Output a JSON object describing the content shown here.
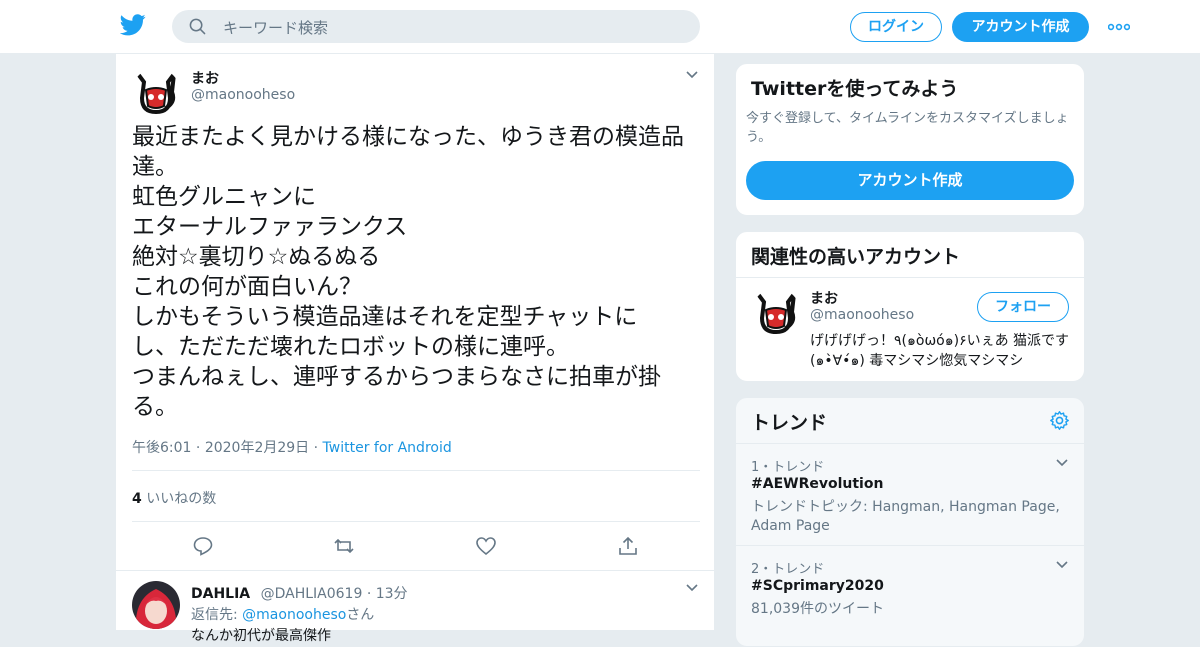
{
  "header": {
    "search_placeholder": "キーワード検索",
    "login_label": "ログイン",
    "signup_label": "アカウント作成"
  },
  "tweet": {
    "name": "まお",
    "handle": "@maonooheso",
    "lines": [
      "最近またよく見かける様になった、ゆうき君の模造品",
      "達。",
      "虹色グルニャンに",
      "エターナルファァランクス",
      "絶対☆裏切り☆ぬるぬる",
      "これの何が面白いん？",
      "しかもそういう模造品達はそれを定型チャットに",
      "し、ただただ壊れたロボットの様に連呼。",
      "つまんねぇし、連呼するからつまらなさに拍車が掛",
      "る。"
    ],
    "time": "午後6:01",
    "date": "2020年2月29日",
    "source": "Twitter for Android",
    "like_count": "4",
    "like_label": "いいねの数"
  },
  "reply": {
    "name": "DAHLIA",
    "handle": "@DAHLIA0619",
    "time": "13分",
    "reply_prefix": "返信先:",
    "reply_to": "@maonooheso",
    "reply_suffix": "さん",
    "text": "なんか初代が最高傑作"
  },
  "sidebar": {
    "signup_card": {
      "title": "Twitterを使ってみよう",
      "desc": "今すぐ登録して、タイムラインをカスタマイズしましょう。",
      "button": "アカウント作成"
    },
    "related": {
      "title": "関連性の高いアカウント",
      "name": "まお",
      "handle": "@maonooheso",
      "follow_label": "フォロー",
      "bio": "げげげげっ！٩(๑òωó๑)۶いぇあ 猫派です(๑•̀∀•́๑) 毒マシマシ惚気マシマシ"
    },
    "trends": {
      "title": "トレンド",
      "items": [
        {
          "meta": "1・トレンド",
          "tag": "#AEWRevolution",
          "sub": "トレンドトピック: Hangman, Hangman Page, Adam Page"
        },
        {
          "meta": "2・トレンド",
          "tag": "#SCprimary2020",
          "sub": "81,039件のツイート"
        }
      ]
    }
  },
  "colors": {
    "accent": "#1da1f2",
    "link": "#1b95e0",
    "muted": "#657786",
    "background": "#e6ecf0"
  }
}
